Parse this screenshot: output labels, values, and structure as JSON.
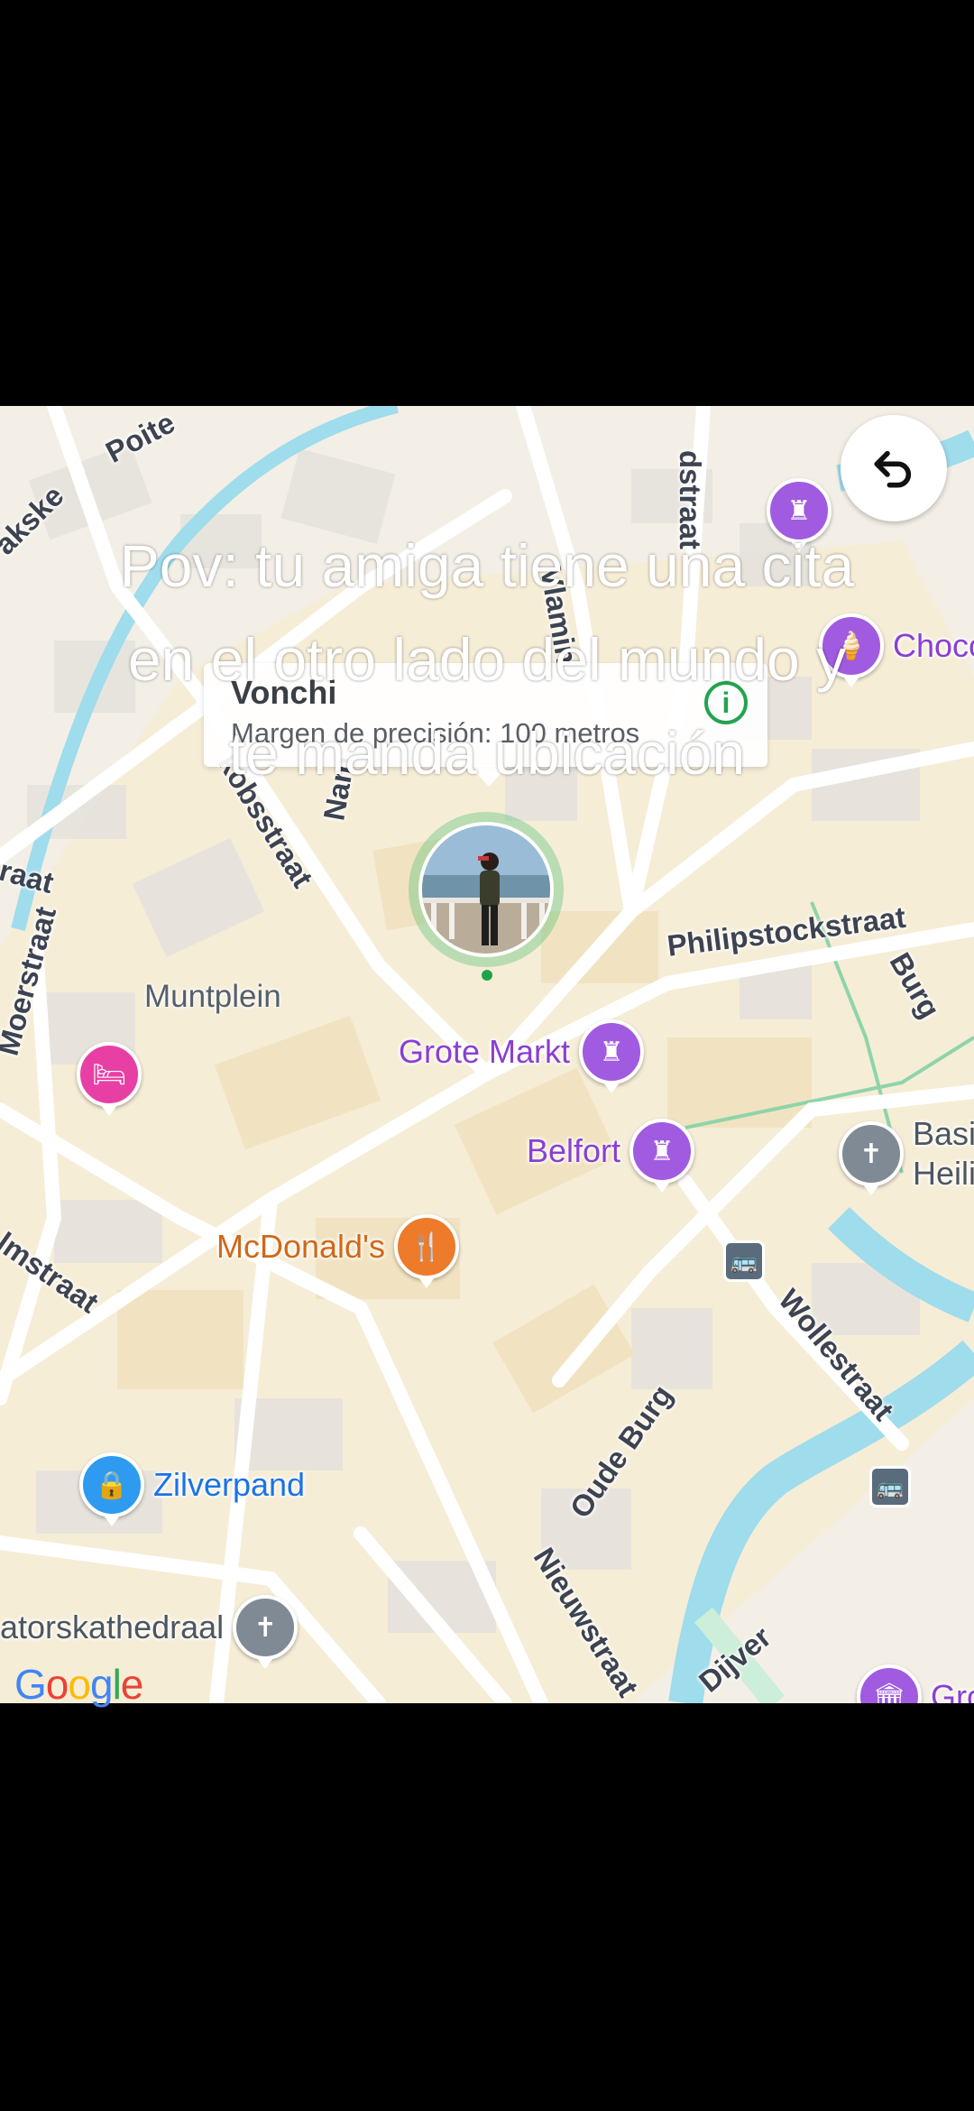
{
  "map": {
    "streets": [
      "Poite",
      "akske",
      "dstraat",
      "raat",
      "Moerstraat",
      "kobsstraat",
      "Nam",
      "Vlamin",
      "Philipstockstraat",
      "Burg",
      "lmstraat",
      "Wollestraat",
      "Oude Burg",
      "Nieuwstraat",
      "Dijver"
    ],
    "areas": [
      "Muntplein"
    ],
    "pois": [
      {
        "label": "Grote Markt",
        "icon": "tower-icon",
        "color": "#a05be0"
      },
      {
        "label": "Belfort",
        "icon": "tower-icon",
        "color": "#a05be0"
      },
      {
        "label": "McDonald's",
        "icon": "fork-knife-icon",
        "color": "#ee7b2a"
      },
      {
        "label": "Zilverpand",
        "icon": "shopping-bag-icon",
        "color": "#2e9bf0"
      },
      {
        "label": "atorskathedraal",
        "icon": "cross-icon",
        "color": "#7f8a95"
      },
      {
        "label": "Basi",
        "label2": "Heili",
        "icon": "cross-icon",
        "color": "#7f8a95"
      },
      {
        "label": "Choco",
        "icon": "ice-cream-icon",
        "color": "#a05be0"
      },
      {
        "label": "Gro",
        "icon": "museum-icon",
        "color": "#a05be0"
      }
    ],
    "google": "Google"
  },
  "location_card": {
    "name": "Vonchi",
    "accuracy": "Margen de precisión: 100 metros"
  },
  "overlay_caption": [
    "Pov: tu amiga tiene una cita",
    "en el otro lado del mundo y",
    "te manda ubicación"
  ]
}
